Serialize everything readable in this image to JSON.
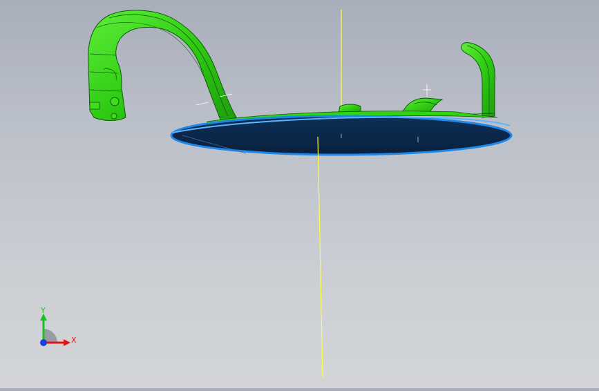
{
  "viewport": {
    "background_top": "#a9aebb",
    "background_bottom": "#d3d5d8",
    "part_color": "#35d619",
    "part_edge_color": "#0d5a07",
    "plate_fill": "#0c2b52",
    "plate_rim": "#1e88e8",
    "axis_line_color": "#ffff40"
  },
  "triad": {
    "x_label": "X",
    "y_label": "Y",
    "x_color": "#e01414",
    "y_color": "#19c21e",
    "origin_color": "#1a3fe0"
  }
}
